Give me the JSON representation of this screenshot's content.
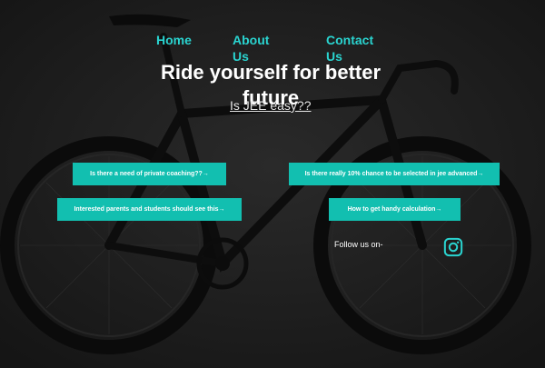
{
  "nav": {
    "home": "Home",
    "about": "About Us",
    "contact": "Contact Us"
  },
  "hero": {
    "title": "Ride yourself for better future",
    "sub_link": "Is JEE easy??"
  },
  "buttons": [
    "Is there a need of private coaching??→",
    "Is there really 10% chance to be selected in jee advanced→",
    "Interested parents and students should see this→",
    "How to get handy calculation→"
  ],
  "social": {
    "follow_text": "Follow us on-",
    "icon": "instagram-icon"
  },
  "colors": {
    "accent": "#2ad4d0",
    "button_bg": "#12bfb0",
    "background": "#1c1c1c"
  }
}
